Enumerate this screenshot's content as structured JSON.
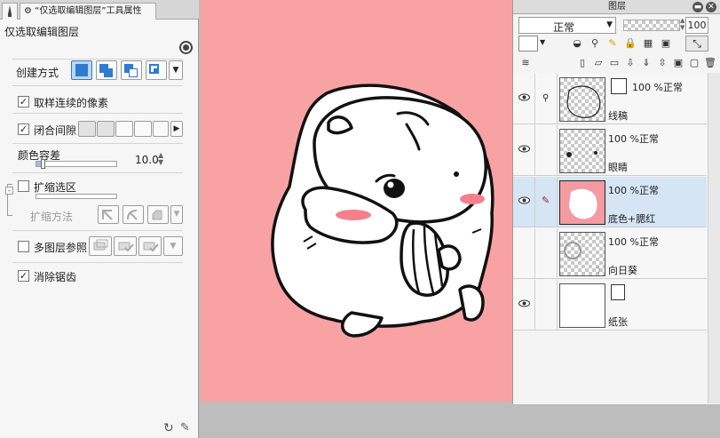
{
  "tool_panel": {
    "tab_label": "“仅选取编辑图层”工具属性",
    "title": "仅选取编辑图层",
    "create_mode_label": "创建方式",
    "sample_contiguous_label": "取样连续的像素",
    "close_gap_label": "闭合间隙",
    "color_tolerance_label": "颜色容差",
    "color_tolerance_value": "10.0",
    "expand_selection_label": "扩缩选区",
    "expand_method_label": "扩缩方法",
    "multi_layer_ref_label": "多图层参照",
    "antialias_label": "消除锯齿",
    "sample_contiguous_checked": "✓",
    "close_gap_checked": "✓",
    "antialias_checked": "✓",
    "color_tolerance_level": 0.05
  },
  "layer_panel": {
    "title": "图层",
    "blend_mode": "正常",
    "opacity_value": "100",
    "layers": [
      {
        "opacity": "100 %正常",
        "name": "线稿"
      },
      {
        "opacity": "100 %正常",
        "name": "眼睛"
      },
      {
        "opacity": "100 %正常",
        "name": "底色+腮红"
      },
      {
        "opacity": "100 %正常",
        "name": "向日葵"
      },
      {
        "opacity": "",
        "name": "纸张"
      }
    ]
  },
  "colors": {
    "canvas_bg": "#f9a2a4",
    "selected_layer": "#d5e5f4",
    "accent": "#2f7bd0"
  }
}
